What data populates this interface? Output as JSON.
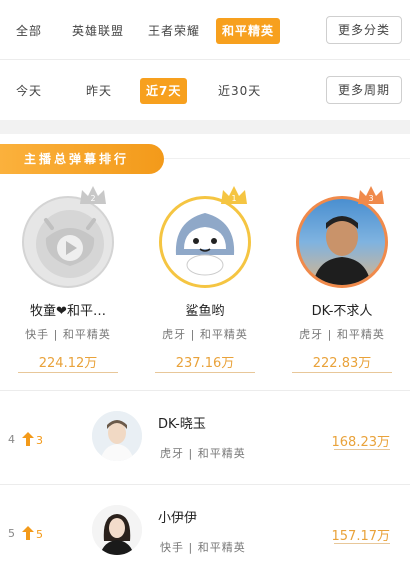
{
  "category_filters": {
    "items": [
      "全部",
      "英雄联盟",
      "王者荣耀",
      "和平精英"
    ],
    "active": "和平精英",
    "more_label": "更多分类"
  },
  "period_filters": {
    "items": [
      "今天",
      "昨天",
      "近7天",
      "近30天"
    ],
    "active": "近7天",
    "more_label": "更多周期"
  },
  "section_title": "主播总弹幕排行",
  "podium": [
    {
      "rank": "2",
      "name": "牧童❤和平…",
      "platform": "快手 | 和平精英",
      "value": "224.12万",
      "crown_color": "#c8c8c8"
    },
    {
      "rank": "1",
      "name": "鲨鱼哟",
      "platform": "虎牙 | 和平精英",
      "value": "237.16万",
      "crown_color": "#f5c542"
    },
    {
      "rank": "3",
      "name": "DK-不求人",
      "platform": "虎牙 | 和平精英",
      "value": "222.83万",
      "crown_color": "#f08a4b"
    }
  ],
  "ranking": [
    {
      "rank": "4",
      "delta": "3",
      "name": "DK-晓玉",
      "platform": "虎牙 | 和平精英",
      "value": "168.23万"
    },
    {
      "rank": "5",
      "delta": "5",
      "name": "小伊伊",
      "platform": "快手 | 和平精英",
      "value": "157.17万"
    }
  ],
  "colors": {
    "accent": "#f7a01e",
    "value": "#e9a23a",
    "border": "#ececec"
  }
}
